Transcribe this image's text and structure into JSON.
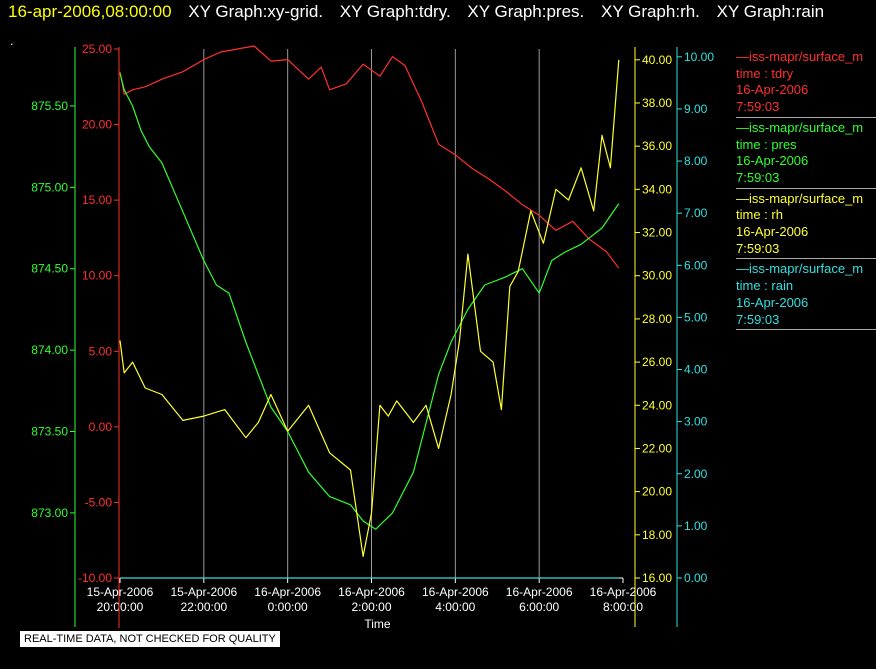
{
  "header": {
    "time": "16-apr-2006,08:00:00",
    "items": [
      "XY Graph:xy-grid.",
      "XY Graph:tdry.",
      "XY Graph:pres.",
      "XY Graph:rh.",
      "XY Graph:rain"
    ]
  },
  "dot": ".",
  "disclaimer": "REAL-TIME DATA, NOT CHECKED FOR QUALITY",
  "legend": [
    {
      "source": "—iss-mapr/surface_m",
      "field": "time : tdry",
      "date": "16-Apr-2006",
      "time": "7:59:03",
      "color": "#ff3030"
    },
    {
      "source": "—iss-mapr/surface_m",
      "field": "time : pres",
      "date": "16-Apr-2006",
      "time": "7:59:03",
      "color": "#30ff30"
    },
    {
      "source": "—iss-mapr/surface_m",
      "field": "time : rh",
      "date": "16-Apr-2006",
      "time": "7:59:03",
      "color": "#ffff30"
    },
    {
      "source": "—iss-mapr/surface_m",
      "field": "time : rain",
      "date": "16-Apr-2006",
      "time": "7:59:03",
      "color": "#30e0e0"
    }
  ],
  "chart_data": {
    "type": "line",
    "xlabel": "Time",
    "x_range": [
      "2006-04-15 20:00",
      "2006-04-16 08:00"
    ],
    "x_ticks": [
      {
        "t": "2006-04-15 20:00",
        "date": "15-Apr-2006",
        "time": "20:00:00"
      },
      {
        "t": "2006-04-15 22:00",
        "date": "15-Apr-2006",
        "time": "22:00:00"
      },
      {
        "t": "2006-04-16 00:00",
        "date": "16-Apr-2006",
        "time": "0:00:00"
      },
      {
        "t": "2006-04-16 02:00",
        "date": "16-Apr-2006",
        "time": "2:00:00"
      },
      {
        "t": "2006-04-16 04:00",
        "date": "16-Apr-2006",
        "time": "4:00:00"
      },
      {
        "t": "2006-04-16 06:00",
        "date": "16-Apr-2006",
        "time": "6:00:00"
      },
      {
        "t": "2006-04-16 08:00",
        "date": "16-Apr-2006",
        "time": "8:00:00"
      }
    ],
    "grid": "vertical",
    "legend_position": "right",
    "axes": [
      {
        "id": "tdry",
        "color": "#ff3030",
        "side": "left-inner",
        "ylim": [
          -10,
          25
        ],
        "ticks": [
          "25.00",
          "20.00",
          "15.00",
          "10.00",
          "5.00",
          "0.00",
          "-5.00",
          "-10.00"
        ]
      },
      {
        "id": "pres",
        "color": "#30ff30",
        "side": "left-outer",
        "ylim": [
          872.6,
          875.85
        ],
        "ticks": [
          "875.50",
          "875.00",
          "874.50",
          "874.00",
          "873.50",
          "873.00"
        ]
      },
      {
        "id": "rh",
        "color": "#ffff30",
        "side": "right-inner",
        "ylim": [
          16,
          40.5
        ],
        "ticks": [
          "40.00",
          "38.00",
          "36.00",
          "34.00",
          "32.00",
          "30.00",
          "28.00",
          "26.00",
          "24.00",
          "22.00",
          "20.00",
          "18.00",
          "16.00"
        ]
      },
      {
        "id": "rain",
        "color": "#30e0e0",
        "side": "right-outer",
        "ylim": [
          0,
          10.15
        ],
        "ticks": [
          "10.00",
          "9.00",
          "8.00",
          "7.00",
          "6.00",
          "5.00",
          "4.00",
          "3.00",
          "2.00",
          "1.00",
          "0.00"
        ]
      }
    ],
    "series": [
      {
        "name": "time : tdry",
        "axis": "tdry",
        "color": "#ff3030",
        "x": [
          20.0,
          20.1,
          20.3,
          20.6,
          21.0,
          21.5,
          22.0,
          22.4,
          22.8,
          23.2,
          23.4,
          23.6,
          24.0,
          24.5,
          24.8,
          25.0,
          25.4,
          25.8,
          26.2,
          26.5,
          26.8,
          27.2,
          27.6,
          28.0,
          28.4,
          28.8,
          29.2,
          29.6,
          30.0,
          30.4,
          30.8,
          31.2,
          31.6,
          31.9
        ],
        "y": [
          23.5,
          22.0,
          22.3,
          22.5,
          23.0,
          23.5,
          24.3,
          24.8,
          25.0,
          25.2,
          24.7,
          24.2,
          24.3,
          23.0,
          23.8,
          22.3,
          22.7,
          24.0,
          23.2,
          24.5,
          23.9,
          21.5,
          18.7,
          18.0,
          17.1,
          16.4,
          15.6,
          14.7,
          14.0,
          13.0,
          13.6,
          12.4,
          11.6,
          10.5
        ]
      },
      {
        "name": "time : pres",
        "axis": "pres",
        "color": "#30ff30",
        "x": [
          20.0,
          20.1,
          20.3,
          20.5,
          20.7,
          21.0,
          21.5,
          22.0,
          22.3,
          22.6,
          23.0,
          23.3,
          23.6,
          24.0,
          24.5,
          25.0,
          25.5,
          25.8,
          26.1,
          26.5,
          27.0,
          27.3,
          27.6,
          27.9,
          28.3,
          28.7,
          29.2,
          29.6,
          30.0,
          30.3,
          30.6,
          31.0,
          31.5,
          31.9
        ],
        "y": [
          875.7,
          875.6,
          875.5,
          875.35,
          875.25,
          875.15,
          874.85,
          874.55,
          874.4,
          874.35,
          874.05,
          873.85,
          873.65,
          873.5,
          873.25,
          873.1,
          873.05,
          872.95,
          872.9,
          873.0,
          873.25,
          873.55,
          873.85,
          874.05,
          874.25,
          874.4,
          874.45,
          874.5,
          874.35,
          874.55,
          874.6,
          874.65,
          874.75,
          874.9
        ]
      },
      {
        "name": "time : rh",
        "axis": "rh",
        "color": "#ffff30",
        "x": [
          20.0,
          20.1,
          20.3,
          20.6,
          21.0,
          21.5,
          22.0,
          22.5,
          23.0,
          23.3,
          23.6,
          24.0,
          24.5,
          25.0,
          25.5,
          25.8,
          26.0,
          26.2,
          26.4,
          26.6,
          27.0,
          27.3,
          27.6,
          27.9,
          28.1,
          28.3,
          28.6,
          28.9,
          29.1,
          29.3,
          29.5,
          29.8,
          30.1,
          30.4,
          30.7,
          31.0,
          31.3,
          31.5,
          31.7,
          31.9
        ],
        "y": [
          27.0,
          25.5,
          26.0,
          24.8,
          24.5,
          23.3,
          23.5,
          23.8,
          22.5,
          23.2,
          24.5,
          22.8,
          24.0,
          21.8,
          21.0,
          17.0,
          19.0,
          24.0,
          23.5,
          24.2,
          23.2,
          24.0,
          22.0,
          24.5,
          27.0,
          31.0,
          26.5,
          26.0,
          23.8,
          29.5,
          30.2,
          33.0,
          31.5,
          34.0,
          33.5,
          35.0,
          33.0,
          36.5,
          35.0,
          40.0
        ]
      },
      {
        "name": "time : rain",
        "axis": "rain",
        "color": "#30e0e0",
        "x": [
          20.0,
          31.9
        ],
        "y": [
          0.0,
          0.0
        ]
      }
    ]
  }
}
